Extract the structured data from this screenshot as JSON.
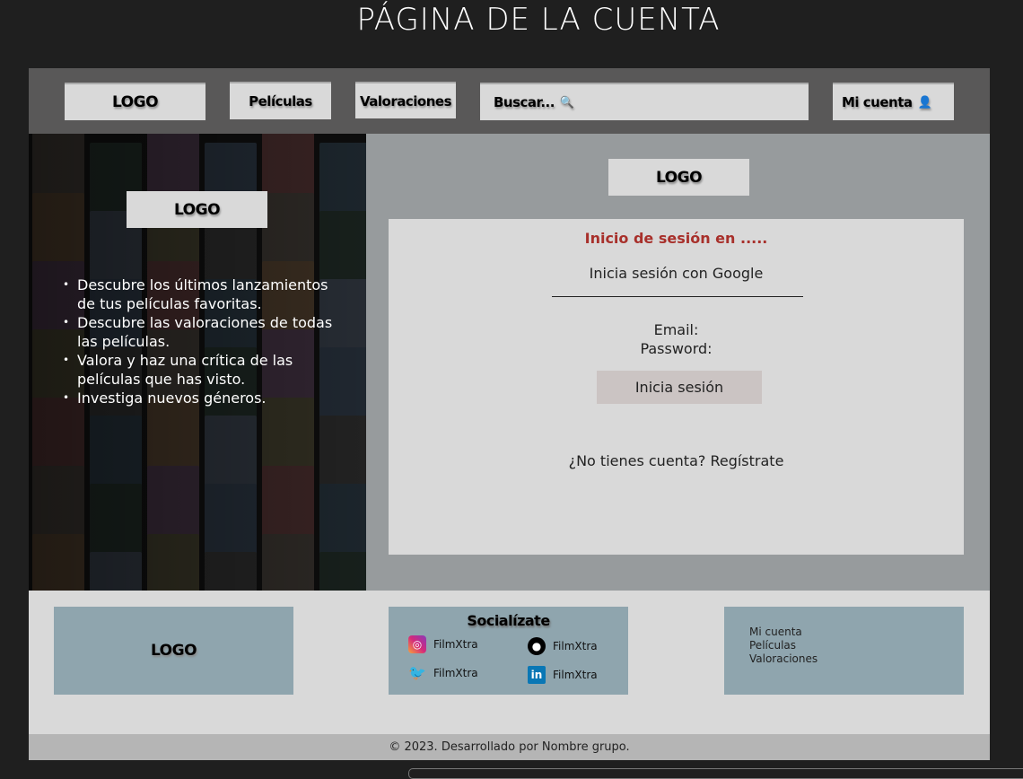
{
  "page_title": "PÁGINA DE LA CUENTA",
  "nav": {
    "logo": "LOGO",
    "peliculas": "Películas",
    "valoraciones": "Valoraciones",
    "search_placeholder": "Buscar...",
    "mi_cuenta": "Mi cuenta"
  },
  "left": {
    "logo": "LOGO",
    "features": [
      "Descubre los últimos lanzamientos de tus películas favoritas.",
      "Descubre las valoraciones de todas las películas.",
      "Valora y haz una crítica de las películas que has visto.",
      "Investiga nuevos géneros."
    ]
  },
  "login": {
    "logo": "LOGO",
    "heading": "Inicio de sesión en .....",
    "google": "Inicia sesión con Google",
    "email_label": "Email:",
    "password_label": "Password:",
    "submit": "Inicia sesión",
    "register": "¿No tienes cuenta? Regístrate",
    "heading_color": "#a8302b"
  },
  "footer": {
    "logo": "LOGO",
    "social_title": "Socialízate",
    "social": [
      {
        "icon": "instagram-icon",
        "label": "FilmXtra"
      },
      {
        "icon": "github-icon",
        "label": "FilmXtra"
      },
      {
        "icon": "twitter-icon",
        "label": "FilmXtra"
      },
      {
        "icon": "linkedin-icon",
        "label": "FilmXtra"
      }
    ],
    "links": [
      "Mi cuenta",
      "Películas",
      "Valoraciones"
    ],
    "copyright": "© 2023. Desarrollado por Nombre grupo."
  }
}
